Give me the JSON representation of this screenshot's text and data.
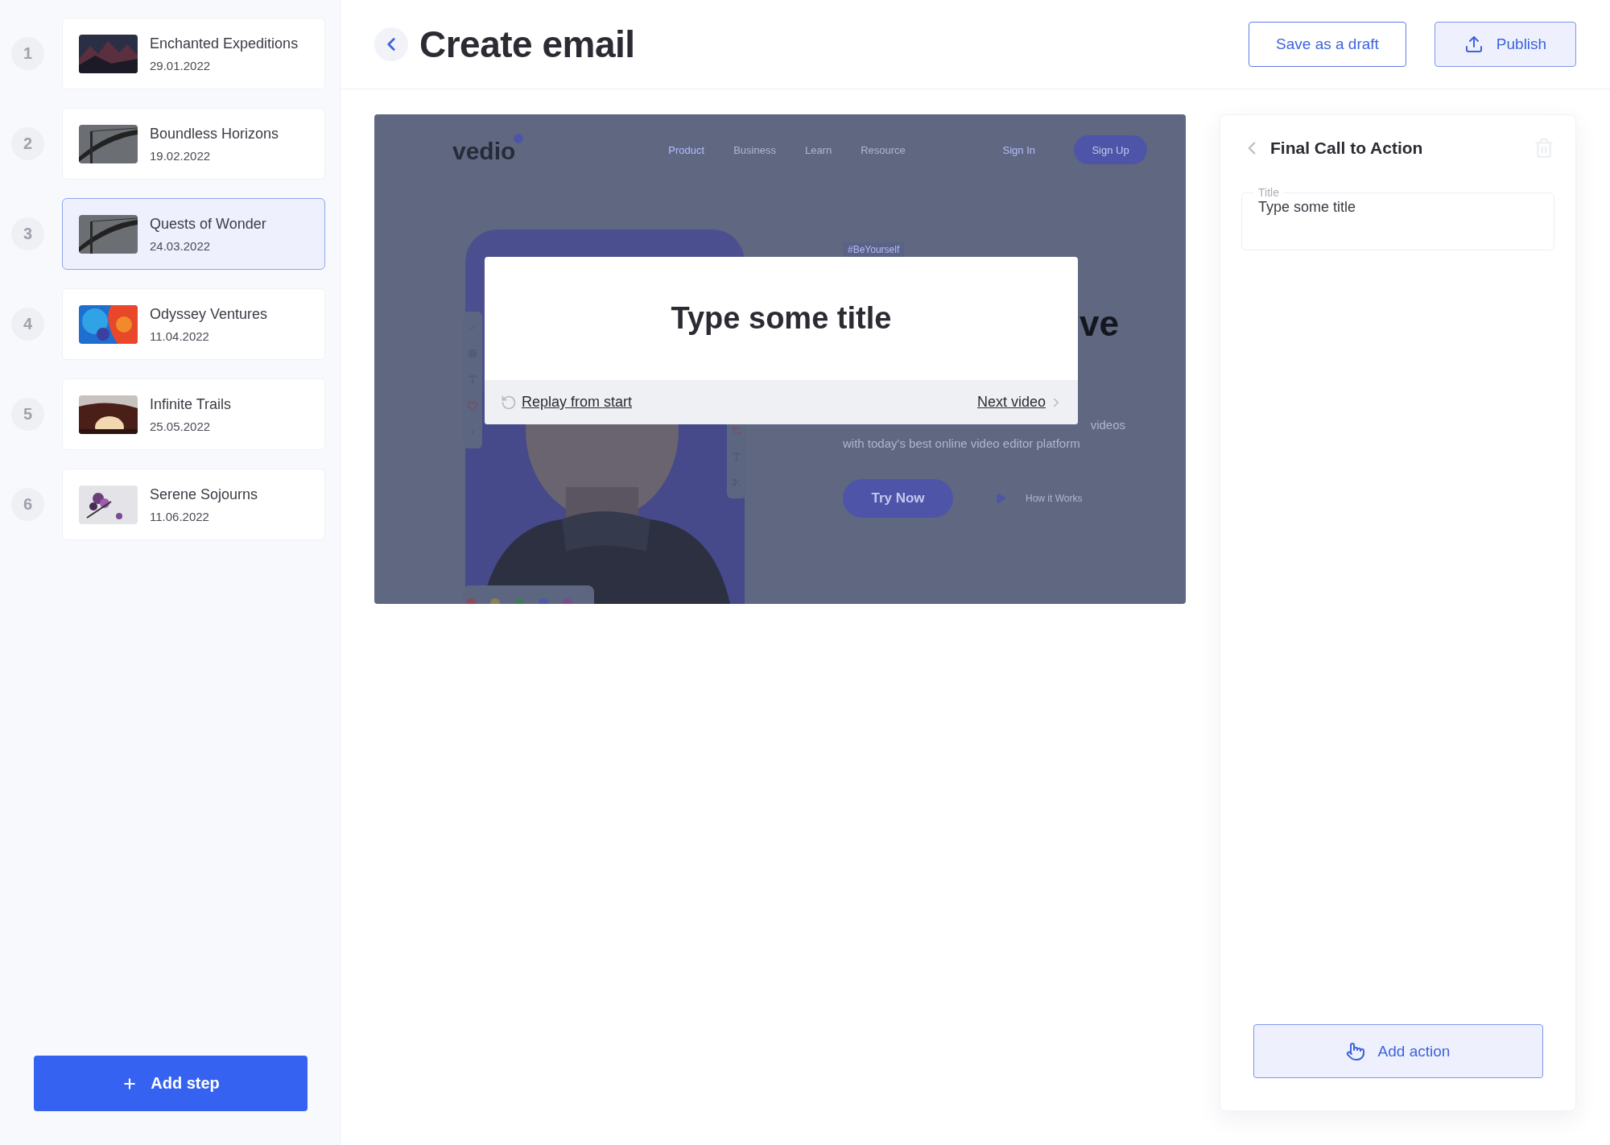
{
  "steps": [
    {
      "number": "1",
      "title": "Enchanted Expeditions",
      "date": "29.01.2022",
      "selected": false
    },
    {
      "number": "2",
      "title": "Boundless Horizons",
      "date": "19.02.2022",
      "selected": false
    },
    {
      "number": "3",
      "title": "Quests of Wonder",
      "date": "24.03.2022",
      "selected": true
    },
    {
      "number": "4",
      "title": "Odyssey Ventures",
      "date": "11.04.2022",
      "selected": false
    },
    {
      "number": "5",
      "title": "Infinite Trails",
      "date": "25.05.2022",
      "selected": false
    },
    {
      "number": "6",
      "title": "Serene Sojourns",
      "date": "11.06.2022",
      "selected": false
    }
  ],
  "add_step_button": "Add step",
  "header": {
    "title": "Create email",
    "draft_button": "Save as a draft",
    "publish_button": "Publish"
  },
  "preview": {
    "website": {
      "logo": "vedio",
      "nav": [
        {
          "label": "Product",
          "selected": true
        },
        {
          "label": "Business",
          "selected": false
        },
        {
          "label": "Learn",
          "selected": false
        },
        {
          "label": "Resource",
          "selected": false
        }
      ],
      "sign_in": "Sign In",
      "sign_up": "Sign Up",
      "hashtag": "#BeYourself",
      "heading_fragment": "ve",
      "text_fragment": "videos",
      "tagline": "with today's best online video editor platform",
      "primary_button": "Try Now",
      "secondary_link": "How it Works"
    },
    "modal": {
      "title": "Type some title",
      "replay_link": "Replay from start",
      "next_link": "Next video"
    }
  },
  "panel": {
    "title": "Final Call to Action",
    "field": {
      "label": "Title",
      "value": "Type some title"
    },
    "add_action_button": "Add action"
  }
}
